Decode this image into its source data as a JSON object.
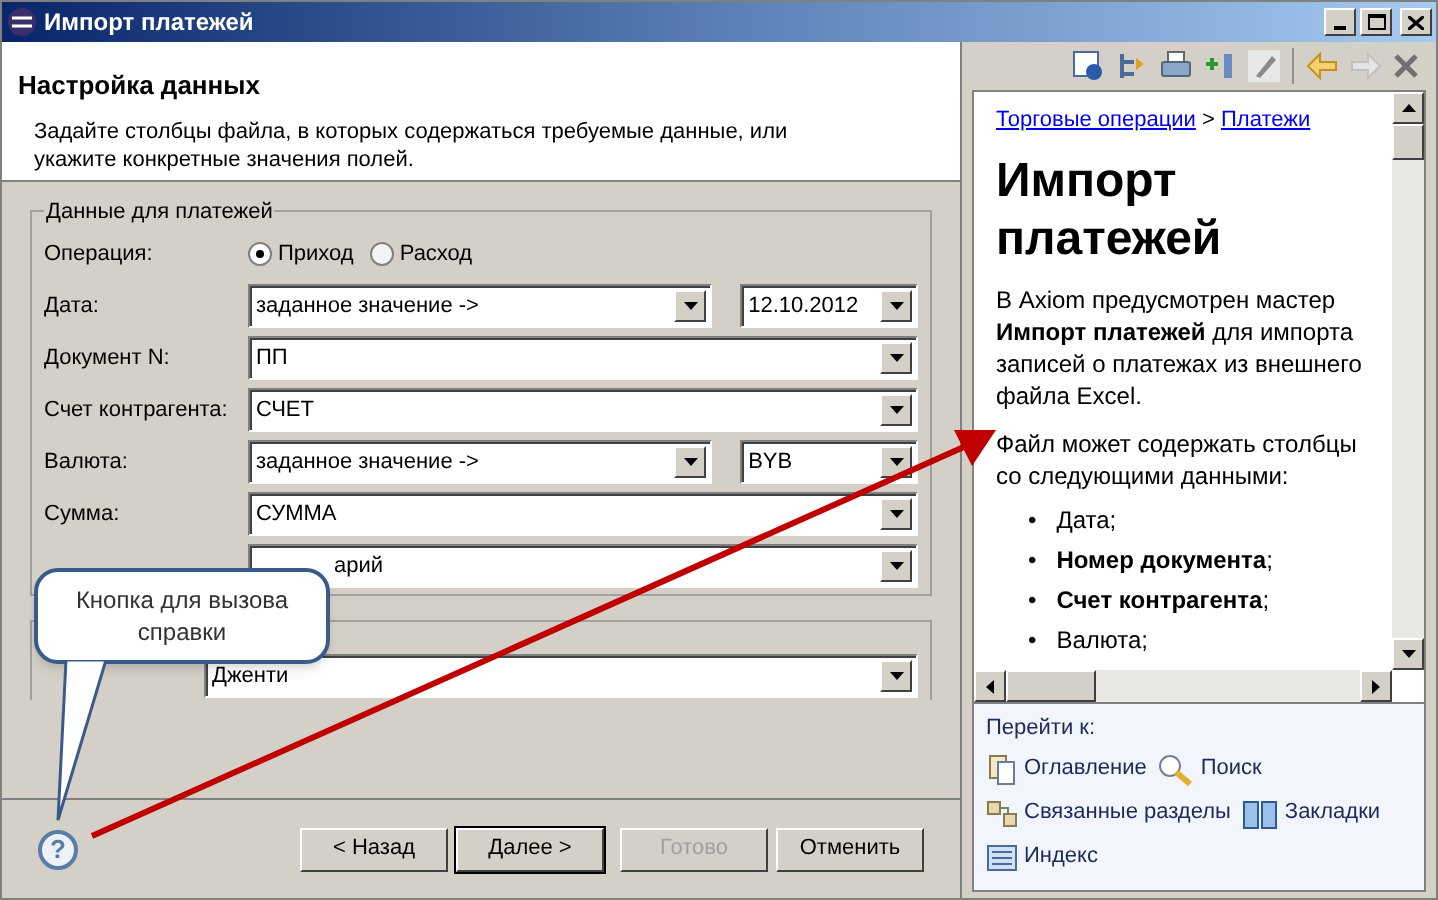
{
  "window": {
    "title": "Импорт платежей"
  },
  "header": {
    "title": "Настройка данных",
    "description": "Задайте столбцы файла, в которых содержаться требуемые данные, или укажите конкретные значения полей."
  },
  "group": {
    "title": "Данные для платежей",
    "rows": [
      {
        "kind": "radio",
        "label": "Операция:",
        "options": [
          {
            "label": "Приход",
            "selected": true
          },
          {
            "label": "Расход",
            "selected": false
          }
        ]
      },
      {
        "kind": "combo",
        "label": "Дата:",
        "value": "заданное значение ->",
        "extra": "12.10.2012"
      },
      {
        "kind": "combo",
        "label": "Документ N:",
        "value": "ПП"
      },
      {
        "kind": "combo",
        "label": "Счет контрагента:",
        "value": "СЧЕТ"
      },
      {
        "kind": "combo",
        "label": "Валюта:",
        "value": "заданное значение ->",
        "extra": "BYB"
      },
      {
        "kind": "combo",
        "label": "Сумма:",
        "value": "СУММА"
      },
      {
        "kind": "combo",
        "value": "арий"
      }
    ]
  },
  "group2": {
    "rows": [
      {
        "kind": "combo",
        "value": "Дженти"
      }
    ]
  },
  "help_button": {
    "label": "?"
  },
  "buttons": [
    {
      "label": "< Назад",
      "disabled": false,
      "default": false
    },
    {
      "label": "Далее >",
      "disabled": false,
      "default": true
    },
    {
      "label": "Готово",
      "disabled": true,
      "default": false
    },
    {
      "label": "Отменить",
      "disabled": false,
      "default": false
    }
  ],
  "callout": {
    "text": "Кнопка для вызова справки"
  },
  "help": {
    "breadcrumb": [
      "Торговые операции",
      "Платежи"
    ],
    "separator": ">",
    "title": "Импорт платежей",
    "paragraphs": [
      "В Axiom предусмотрен мастер **Импорт платежей** для импорта записей о платежах из внешнего файла Excel.",
      "Файл может содержать столбцы со следующими данными:"
    ],
    "list_marker": "•",
    "list": [
      "Дата;",
      "**Номер документа**;",
      "**Счет контрагента**;",
      "Валюта;"
    ],
    "goto": {
      "title": "Перейти к:",
      "links": [
        {
          "label": "Оглавление",
          "kind": "contents"
        },
        {
          "label": "Поиск",
          "kind": "search"
        },
        {
          "label": "Связанные разделы",
          "kind": "related"
        },
        {
          "label": "Закладки",
          "kind": "bookmarks"
        },
        {
          "label": "Индекс",
          "kind": "index"
        }
      ]
    }
  }
}
